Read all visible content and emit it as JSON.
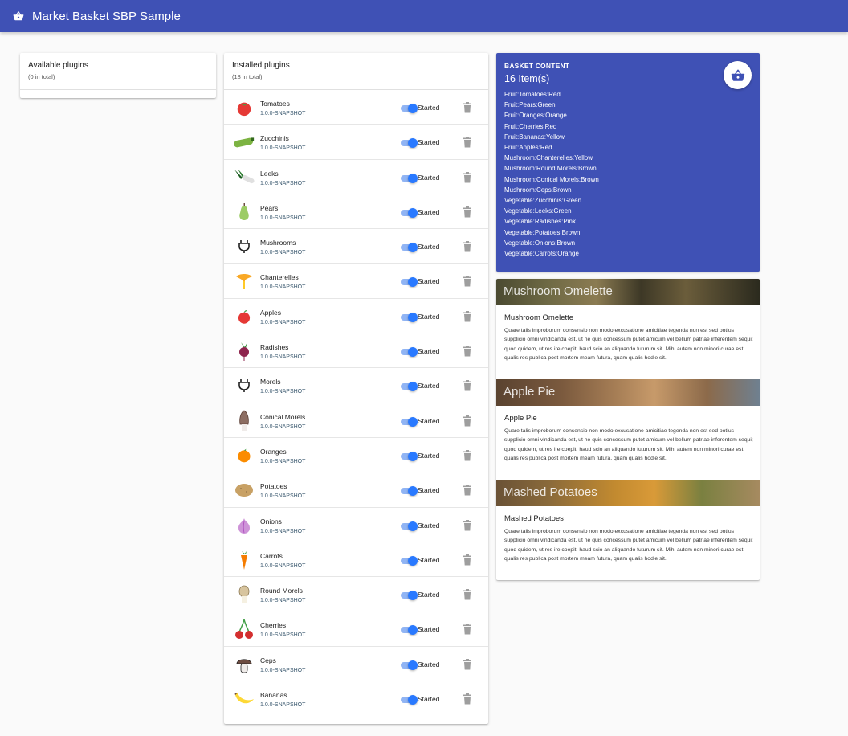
{
  "app": {
    "title": "Market Basket SBP Sample",
    "icon": "basket-icon"
  },
  "available": {
    "title": "Available plugins",
    "count_text": "(0 in total)"
  },
  "installed": {
    "title": "Installed plugins",
    "count_text": "(18 in total)",
    "status_label": "Started",
    "plugins": [
      {
        "name": "Tomatoes",
        "version": "1.0.0-SNAPSHOT",
        "icon": "tomato-icon",
        "started": true
      },
      {
        "name": "Zucchinis",
        "version": "1.0.0-SNAPSHOT",
        "icon": "zucchini-icon",
        "started": true
      },
      {
        "name": "Leeks",
        "version": "1.0.0-SNAPSHOT",
        "icon": "leek-icon",
        "started": true
      },
      {
        "name": "Pears",
        "version": "1.0.0-SNAPSHOT",
        "icon": "pear-icon",
        "started": true
      },
      {
        "name": "Mushrooms",
        "version": "1.0.0-SNAPSHOT",
        "icon": "plug-icon",
        "started": true
      },
      {
        "name": "Chanterelles",
        "version": "1.0.0-SNAPSHOT",
        "icon": "chanterelle-icon",
        "started": true
      },
      {
        "name": "Apples",
        "version": "1.0.0-SNAPSHOT",
        "icon": "apple-icon",
        "started": true
      },
      {
        "name": "Radishes",
        "version": "1.0.0-SNAPSHOT",
        "icon": "radish-icon",
        "started": true
      },
      {
        "name": "Morels",
        "version": "1.0.0-SNAPSHOT",
        "icon": "plug-icon",
        "started": true
      },
      {
        "name": "Conical Morels",
        "version": "1.0.0-SNAPSHOT",
        "icon": "morel-icon",
        "started": true
      },
      {
        "name": "Oranges",
        "version": "1.0.0-SNAPSHOT",
        "icon": "orange-icon",
        "started": true
      },
      {
        "name": "Potatoes",
        "version": "1.0.0-SNAPSHOT",
        "icon": "potato-icon",
        "started": true
      },
      {
        "name": "Onions",
        "version": "1.0.0-SNAPSHOT",
        "icon": "onion-icon",
        "started": true
      },
      {
        "name": "Carrots",
        "version": "1.0.0-SNAPSHOT",
        "icon": "carrot-icon",
        "started": true
      },
      {
        "name": "Round Morels",
        "version": "1.0.0-SNAPSHOT",
        "icon": "round-morel-icon",
        "started": true
      },
      {
        "name": "Cherries",
        "version": "1.0.0-SNAPSHOT",
        "icon": "cherry-icon",
        "started": true
      },
      {
        "name": "Ceps",
        "version": "1.0.0-SNAPSHOT",
        "icon": "cep-icon",
        "started": true
      },
      {
        "name": "Bananas",
        "version": "1.0.0-SNAPSHOT",
        "icon": "banana-icon",
        "started": true
      }
    ]
  },
  "basket": {
    "title": "BASKET CONTENT",
    "count_text": "16 Item(s)",
    "items": [
      "Fruit:Tomatoes:Red",
      "Fruit:Pears:Green",
      "Fruit:Oranges:Orange",
      "Fruit:Cherries:Red",
      "Fruit:Bananas:Yellow",
      "Fruit:Apples:Red",
      "Mushroom:Chanterelles:Yellow",
      "Mushroom:Round Morels:Brown",
      "Mushroom:Conical Morels:Brown",
      "Mushroom:Ceps:Brown",
      "Vegetable:Zucchinis:Green",
      "Vegetable:Leeks:Green",
      "Vegetable:Radishes:Pink",
      "Vegetable:Potatoes:Brown",
      "Vegetable:Onions:Brown",
      "Vegetable:Carrots:Orange"
    ]
  },
  "recipes": [
    {
      "overlay": "Mushroom Omelette",
      "title": "Mushroom Omelette",
      "text": "Quare talis improborum consensio non modo excusatione amicitiae tegenda non est sed potius supplicio omni vindicanda est, ut ne quis concessum putet amicum vel bellum patriae inferentem sequi; quod quidem, ut res ire coepit, haud scio an aliquando futurum sit. Mihi autem non minori curae est, qualis res publica post mortem meam futura, quam qualis hodie sit."
    },
    {
      "overlay": "Apple Pie",
      "title": "Apple Pie",
      "text": "Quare talis improborum consensio non modo excusatione amicitiae tegenda non est sed potius supplicio omni vindicanda est, ut ne quis concessum putet amicum vel bellum patriae inferentem sequi; quod quidem, ut res ire coepit, haud scio an aliquando futurum sit. Mihi autem non minori curae est, qualis res publica post mortem meam futura, quam qualis hodie sit."
    },
    {
      "overlay": "Mashed Potatoes",
      "title": "Mashed Potatoes",
      "text": "Quare talis improborum consensio non modo excusatione amicitiae tegenda non est sed potius supplicio omni vindicanda est, ut ne quis concessum putet amicum vel bellum patriae inferentem sequi; quod quidem, ut res ire coepit, haud scio an aliquando futurum sit. Mihi autem non minori curae est, qualis res publica post mortem meam futura, quam qualis hodie sit."
    }
  ],
  "colors": {
    "primary": "#3f51b5",
    "toggle_on": "#2979ff",
    "toggle_track": "#90b4f4"
  }
}
